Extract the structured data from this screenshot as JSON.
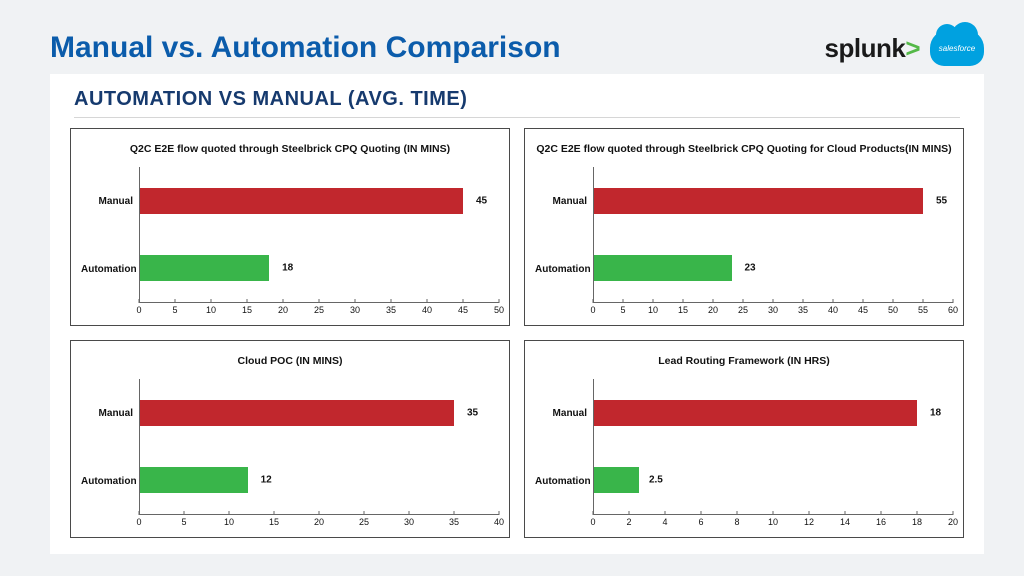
{
  "header": {
    "title": "Manual vs. Automation Comparison",
    "splunk_text": "splunk",
    "salesforce_text": "salesforce"
  },
  "section_title": "AUTOMATION VS MANUAL (AVG. TIME)",
  "colors": {
    "manual": "#c1272d",
    "automation": "#39b54a"
  },
  "chart_data": [
    {
      "type": "bar",
      "orientation": "horizontal",
      "title": "Q2C E2E flow quoted through Steelbrick CPQ Quoting  (IN MINS)",
      "categories": [
        "Manual",
        "Automation"
      ],
      "values": [
        45,
        18
      ],
      "xlim": [
        0,
        50
      ],
      "xticks": [
        0,
        5,
        10,
        15,
        20,
        25,
        30,
        35,
        40,
        45,
        50
      ],
      "series_colors": [
        "manual",
        "automation"
      ]
    },
    {
      "type": "bar",
      "orientation": "horizontal",
      "title": "Q2C E2E flow quoted through Steelbrick CPQ Quoting for Cloud Products(IN MINS)",
      "categories": [
        "Manual",
        "Automation"
      ],
      "values": [
        55,
        23
      ],
      "xlim": [
        0,
        60
      ],
      "xticks": [
        0,
        5,
        10,
        15,
        20,
        25,
        30,
        35,
        40,
        45,
        50,
        55,
        60
      ],
      "series_colors": [
        "manual",
        "automation"
      ]
    },
    {
      "type": "bar",
      "orientation": "horizontal",
      "title": "Cloud POC (IN MINS)",
      "categories": [
        "Manual",
        "Automation"
      ],
      "values": [
        35,
        12
      ],
      "xlim": [
        0,
        40
      ],
      "xticks": [
        0,
        5,
        10,
        15,
        20,
        25,
        30,
        35,
        40
      ],
      "series_colors": [
        "manual",
        "automation"
      ]
    },
    {
      "type": "bar",
      "orientation": "horizontal",
      "title": "Lead Routing Framework (IN HRS)",
      "categories": [
        "Manual",
        "Automation"
      ],
      "values": [
        18,
        2.5
      ],
      "xlim": [
        0,
        20
      ],
      "xticks": [
        0,
        2,
        4,
        6,
        8,
        10,
        12,
        14,
        16,
        18,
        20
      ],
      "series_colors": [
        "manual",
        "automation"
      ]
    }
  ]
}
